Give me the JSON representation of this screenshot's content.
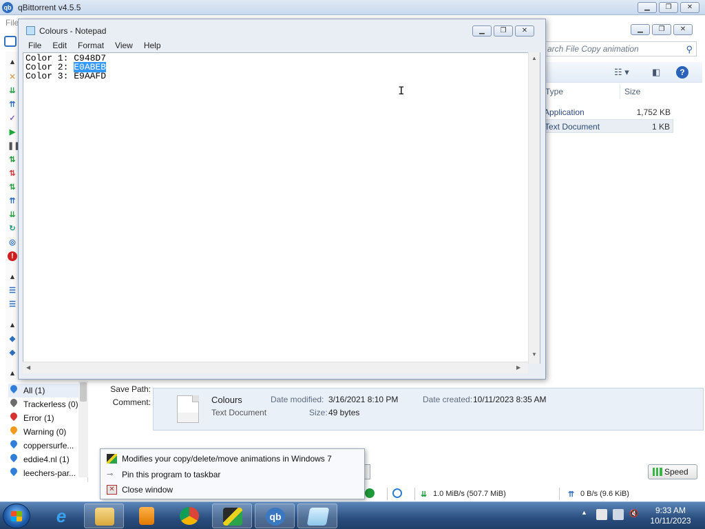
{
  "qbittorrent": {
    "title": "qBittorrent v4.5.5",
    "menu_file": "File",
    "filters": [
      {
        "label": "All (1)",
        "color": "#2f7fd8"
      },
      {
        "label": "Trackerless (0)",
        "color": "#6c6c6c"
      },
      {
        "label": "Error (1)",
        "color": "#d63232"
      },
      {
        "label": "Warning (0)",
        "color": "#f29a1e"
      },
      {
        "label": "coppersurfe...",
        "color": "#2f7fd8"
      },
      {
        "label": "eddie4.nl (1)",
        "color": "#2f7fd8"
      },
      {
        "label": "leechers-par...",
        "color": "#2f7fd8"
      }
    ],
    "properties": {
      "save_path_label": "Save Path:",
      "comment_label": "Comment:"
    },
    "statusbar": {
      "download": "1.0 MiB/s (507.7 MiB)",
      "upload": "0 B/s (9.6 KiB)"
    },
    "speed_button": "Speed"
  },
  "explorer": {
    "search_placeholder": "arch File Copy animation",
    "columns": {
      "type": "Type",
      "size": "Size"
    },
    "rows": [
      {
        "type": "Application",
        "size": "1,752 KB"
      },
      {
        "type": "Text Document",
        "size": "1 KB"
      }
    ],
    "details": {
      "name": "Colours",
      "type": "Text Document",
      "date_modified_label": "Date modified:",
      "date_modified": "3/16/2021 8:10 PM",
      "date_created_label": "Date created:",
      "date_created": "10/11/2023 8:35 AM",
      "size_label": "Size:",
      "size": "49 bytes"
    }
  },
  "notepad": {
    "title": "Colours - Notepad",
    "menu": [
      "File",
      "Edit",
      "Format",
      "View",
      "Help"
    ],
    "lines": [
      {
        "prefix": "Color 1: ",
        "value": "C948D7"
      },
      {
        "prefix": "Color 2: ",
        "value": "E0ABEB"
      },
      {
        "prefix": "Color 3: ",
        "value": "E9AAFD"
      }
    ]
  },
  "jump_list": {
    "items": [
      {
        "label": "Modifies your copy/delete/move animations in Windows 7",
        "icon": "app-icon"
      },
      {
        "label": "Pin this program to taskbar",
        "icon": "pin-icon"
      },
      {
        "label": "Close window",
        "icon": "close-window-icon"
      }
    ]
  },
  "taskbar": {
    "time": "9:33 AM",
    "date": "10/11/2023"
  },
  "colors": {
    "selection": "#3399ff",
    "taskbar": "#2a4e7e"
  }
}
